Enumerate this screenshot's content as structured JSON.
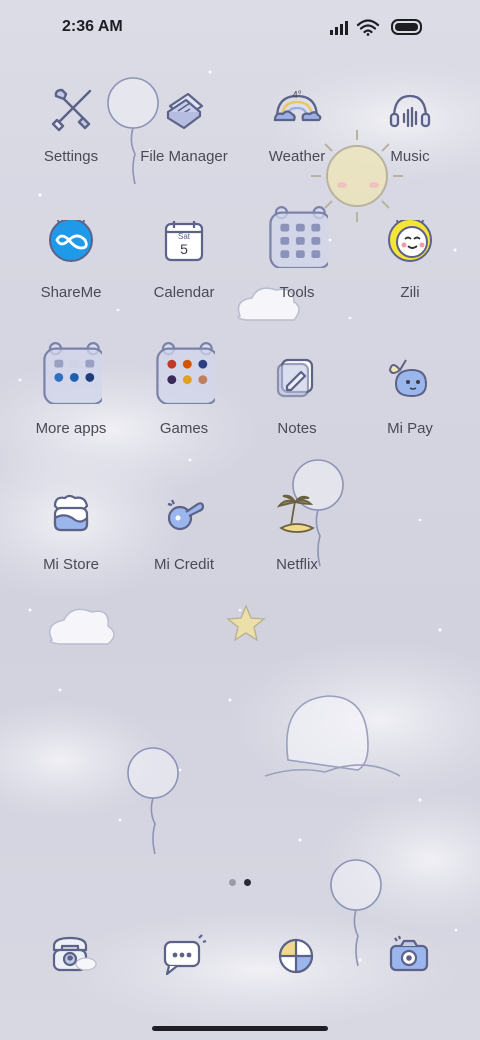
{
  "status_bar": {
    "time": "2:36 AM",
    "icons": [
      "signal-icon",
      "wifi-icon",
      "battery-icon"
    ]
  },
  "apps": [
    {
      "label": "Settings",
      "icon": "settings-icon"
    },
    {
      "label": "File Manager",
      "icon": "file-manager-icon"
    },
    {
      "label": "Weather",
      "icon": "weather-icon",
      "icon_text": "4°"
    },
    {
      "label": "Music",
      "icon": "music-icon"
    },
    {
      "label": "ShareMe",
      "icon": "shareme-icon"
    },
    {
      "label": "Calendar",
      "icon": "calendar-icon",
      "icon_day": "Sat",
      "icon_date": "5"
    },
    {
      "label": "Tools",
      "icon": "tools-folder-icon"
    },
    {
      "label": "Zili",
      "icon": "zili-icon"
    },
    {
      "label": "More apps",
      "icon": "more-apps-folder-icon"
    },
    {
      "label": "Games",
      "icon": "games-folder-icon"
    },
    {
      "label": "Notes",
      "icon": "notes-icon"
    },
    {
      "label": "Mi Pay",
      "icon": "mi-pay-icon"
    },
    {
      "label": "Mi Store",
      "icon": "mi-store-icon"
    },
    {
      "label": "Mi Credit",
      "icon": "mi-credit-icon"
    },
    {
      "label": "Netflix",
      "icon": "netflix-icon"
    }
  ],
  "dock": [
    {
      "icon": "phone-icon"
    },
    {
      "icon": "messages-icon"
    },
    {
      "icon": "browser-icon"
    },
    {
      "icon": "camera-icon"
    }
  ],
  "pages": {
    "count": 2,
    "active": 2
  },
  "colors": {
    "line": "#7b82a8",
    "label": "#4a4a55",
    "shareme_blue": "#1f9ae8",
    "zili_yellow": "#f4e536",
    "sun_yellow": "#f4e7a8"
  }
}
